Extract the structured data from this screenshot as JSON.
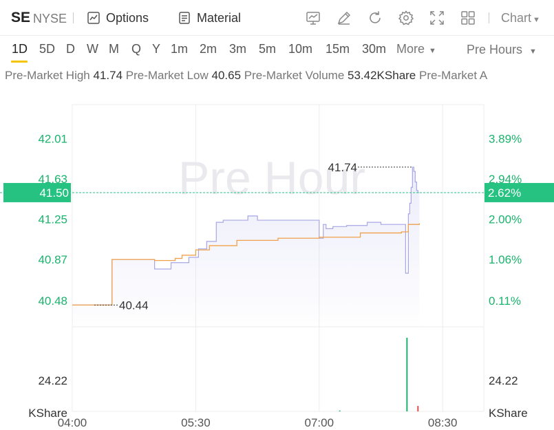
{
  "header": {
    "symbol": "SE",
    "exchange": "NYSE",
    "options_label": "Options",
    "material_label": "Material",
    "chart_label": "Chart"
  },
  "periods": [
    "1D",
    "5D",
    "D",
    "W",
    "M",
    "Q",
    "Y",
    "1m",
    "2m",
    "3m",
    "5m",
    "10m",
    "15m",
    "30m"
  ],
  "active_period": "1D",
  "more_label": "More",
  "session_label": "Pre Hours",
  "info_strip": [
    {
      "label": "Pre-Market High",
      "value": "41.74"
    },
    {
      "label": "Pre-Market Low",
      "value": "40.65"
    },
    {
      "label": "Pre-Market Volume",
      "value": "53.42KShare"
    },
    {
      "label": "Pre-Market A",
      "value": ""
    }
  ],
  "watermark": "Pre Hour",
  "colors": {
    "up": "#19b36b",
    "price_line": "#a6a6e6",
    "avg_line": "#f0a04a",
    "current_tag": "#26c281",
    "accent_underline": "#f5c400"
  },
  "chart_data": {
    "type": "line",
    "x_ticks": [
      "04:00",
      "05:30",
      "07:00",
      "08:30"
    ],
    "y_ticks_left": [
      "42.01",
      "41.63",
      "41.25",
      "40.87",
      "40.48"
    ],
    "y_ticks_right": [
      "3.89%",
      "2.94%",
      "2.00%",
      "1.06%",
      "0.11%"
    ],
    "current_price": "41.50",
    "current_pct": "2.62%",
    "high_label": "41.74",
    "low_label": "40.44",
    "volume_tick": "24.22",
    "volume_unit_left": "KShare",
    "volume_unit_right": "KShare",
    "price": {
      "x": [
        "04:00",
        "04:28",
        "04:29",
        "04:55",
        "05:00",
        "05:06",
        "05:12",
        "05:15",
        "05:20",
        "05:25",
        "05:32",
        "05:38",
        "05:45",
        "05:50",
        "05:55",
        "06:02",
        "06:08",
        "06:15",
        "06:25",
        "06:35",
        "06:45",
        "06:55",
        "07:00",
        "07:03",
        "07:05",
        "07:10",
        "07:20",
        "07:30",
        "07:35",
        "07:45",
        "08:00",
        "08:03",
        "08:05",
        "08:06",
        "08:07",
        "08:08",
        "08:09",
        "08:10",
        "08:11",
        "08:12",
        "08:13"
      ],
      "y": [
        40.44,
        40.44,
        40.87,
        40.87,
        40.78,
        40.78,
        40.84,
        40.84,
        40.84,
        40.89,
        40.97,
        41.04,
        41.22,
        41.24,
        41.24,
        41.24,
        41.28,
        41.24,
        41.24,
        41.24,
        41.24,
        41.24,
        41.07,
        41.2,
        41.16,
        41.18,
        41.19,
        41.19,
        41.22,
        41.2,
        41.2,
        40.74,
        41.3,
        41.4,
        41.55,
        41.74,
        41.7,
        41.6,
        41.52,
        41.5,
        41.5
      ],
      "y_max": 41.74,
      "y_min": 40.44
    },
    "avg_price": {
      "x": [
        "04:00",
        "04:28",
        "04:29",
        "04:55",
        "05:00",
        "05:10",
        "05:15",
        "05:20",
        "05:30",
        "05:40",
        "06:00",
        "06:30",
        "07:00",
        "07:30",
        "08:00",
        "08:05",
        "08:13"
      ],
      "y": [
        40.44,
        40.44,
        40.87,
        40.87,
        40.86,
        40.86,
        40.88,
        40.91,
        40.96,
        41.0,
        41.05,
        41.07,
        41.08,
        41.12,
        41.13,
        41.2,
        41.21
      ]
    },
    "volume": [
      {
        "x": "07:15",
        "v": 0.3,
        "color": "#19b36b"
      },
      {
        "x": "08:04",
        "v": 24.22,
        "color": "#19b36b"
      },
      {
        "x": "08:12",
        "v": 1.8,
        "color": "#e34b4b"
      }
    ],
    "ylim": [
      40.3,
      42.2
    ],
    "volume_max": 26.0
  }
}
